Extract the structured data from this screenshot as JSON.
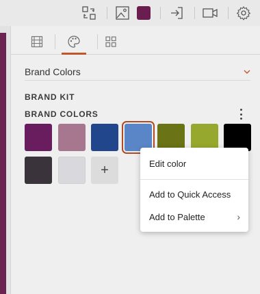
{
  "colors": {
    "accent": "#c2562b",
    "quick_swatch": "#6a1d4f"
  },
  "toolbar": {
    "icons": [
      "swap-icon",
      "image-icon",
      "color-swatch",
      "exit-icon",
      "video-icon",
      "gear-icon"
    ]
  },
  "tabs": [
    "frames-tab",
    "palette-tab",
    "grid-tab"
  ],
  "dropdown": {
    "label": "Brand Colors"
  },
  "sections": {
    "brand_kit": "BRAND KIT",
    "brand_colors": "BRAND COLORS"
  },
  "swatches": [
    "#6a1d5e",
    "#a77790",
    "#22468c",
    "#5a86c8",
    "#6a7316",
    "#97a82e",
    "#000000",
    "#3a333c",
    "#d9d9dd"
  ],
  "selected_swatch": 3,
  "add_label": "+",
  "context_menu": {
    "edit": "Edit color",
    "quick_access": "Add to Quick Access",
    "palette": "Add to Palette",
    "palette_arrow": "›"
  }
}
